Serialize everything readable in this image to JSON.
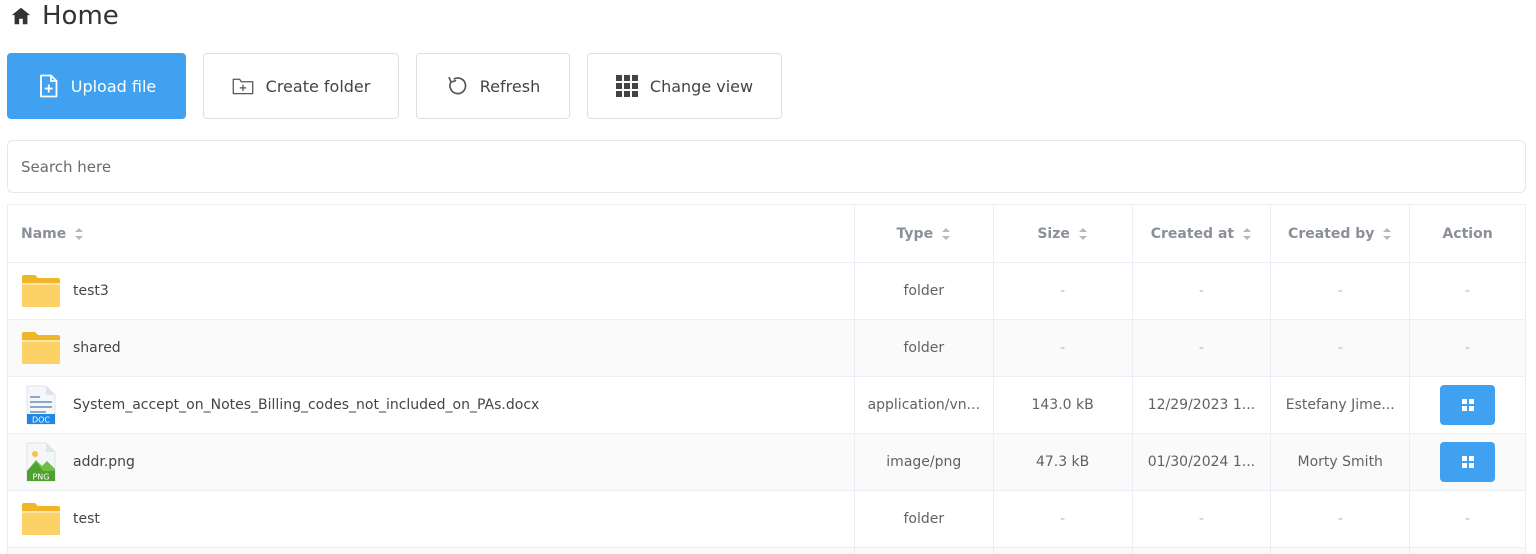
{
  "page": {
    "title": "Home",
    "icon": "home-icon"
  },
  "toolbar": {
    "upload_label": "Upload file",
    "create_folder_label": "Create folder",
    "refresh_label": "Refresh",
    "change_view_label": "Change view",
    "primary_color": "#3fa1f0"
  },
  "search": {
    "placeholder": "Search here",
    "value": ""
  },
  "table": {
    "headers": {
      "name": "Name",
      "type": "Type",
      "size": "Size",
      "created_at": "Created at",
      "created_by": "Created by",
      "action": "Action"
    },
    "rows": [
      {
        "name": "test3",
        "icon": "folder-icon",
        "type": "folder",
        "size": "-",
        "created_at": "-",
        "created_by": "-",
        "action": "-"
      },
      {
        "name": "shared",
        "icon": "folder-icon",
        "type": "folder",
        "size": "-",
        "created_at": "-",
        "created_by": "-",
        "action": "-"
      },
      {
        "name": "System_accept_on_Notes_Billing_codes_not_included_on_PAs.docx",
        "icon": "doc-file-icon",
        "icon_label": "DOC",
        "type": "application/vn...",
        "size": "143.0 kB",
        "created_at": "12/29/2023 1...",
        "created_by": "Estefany Jime...",
        "action": ""
      },
      {
        "name": "addr.png",
        "icon": "png-file-icon",
        "icon_label": "PNG",
        "type": "image/png",
        "size": "47.3 kB",
        "created_at": "01/30/2024 1...",
        "created_by": "Morty Smith",
        "action": ""
      },
      {
        "name": "test",
        "icon": "folder-icon",
        "type": "folder",
        "size": "-",
        "created_at": "-",
        "created_by": "-",
        "action": "-"
      }
    ]
  }
}
